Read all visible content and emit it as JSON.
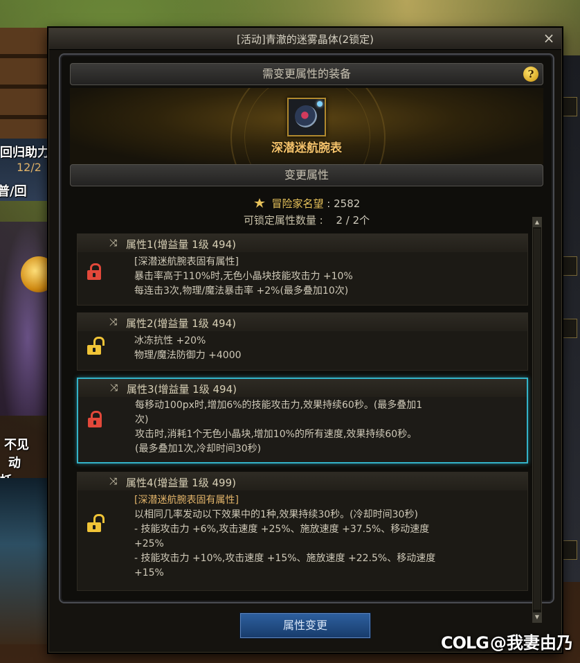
{
  "background": {
    "left_texts": [
      "回归助力",
      "普/回",
      "不见",
      "动",
      "托"
    ],
    "date": "12/2"
  },
  "window": {
    "title": "[活动]青澈的迷雾晶体(2锁定)",
    "close_label": "×"
  },
  "equipment_section": {
    "header": "需变更属性的装备",
    "help_label": "?",
    "item_name": "深潜迷航腕表"
  },
  "change_section": {
    "header": "变更属性",
    "reputation_label": "冒险家名望",
    "reputation_value": ": 2582",
    "lockable_label": "可锁定属性数量 :",
    "lockable_value": "2 / 2个"
  },
  "attributes": [
    {
      "title": "属性1(增益量 1级 494)",
      "locked": true,
      "selected": false,
      "lines": [
        "[深潜迷航腕表固有属性]",
        "暴击率高于110%时,无色小晶块技能攻击力 +10%",
        "每连击3次,物理/魔法暴击率 +2%(最多叠加10次)"
      ]
    },
    {
      "title": "属性2(增益量 1级 494)",
      "locked": false,
      "selected": false,
      "lines": [
        "冰冻抗性 +20%",
        "物理/魔法防御力 +4000"
      ]
    },
    {
      "title": "属性3(增益量 1级 494)",
      "locked": true,
      "selected": true,
      "lines": [
        "每移动100px时,增加6%的技能攻击力,效果持续60秒。(最多叠加1",
        "次)",
        "攻击时,消耗1个无色小晶块,增加10%的所有速度,效果持续60秒。",
        "(最多叠加1次,冷却时间30秒)"
      ]
    },
    {
      "title": "属性4(增益量 1级 499)",
      "locked": false,
      "selected": false,
      "lines": [
        "[深潜迷航腕表固有属性]",
        "以相同几率发动以下效果中的1种,效果持续30秒。(冷却时间30秒)",
        "- 技能攻击力 +6%,攻击速度 +25%、施放速度 +37.5%、移动速度",
        "+25%",
        "- 技能攻击力 +10%,攻击速度 +15%、施放速度 +22.5%、移动速度",
        "+15%"
      ]
    }
  ],
  "scroll": {
    "up_label": "▲",
    "down_label": "▼"
  },
  "actions": {
    "change_button": "属性变更"
  },
  "watermark": {
    "logo": "COLG",
    "text": "@我妻由乃"
  },
  "colors": {
    "accent_gold": "#f4c26a",
    "selected_border": "#33b3c8",
    "lock_locked": "#e2483a",
    "lock_unlocked": "#f0c437",
    "button_blue": "#2d5f9e"
  }
}
